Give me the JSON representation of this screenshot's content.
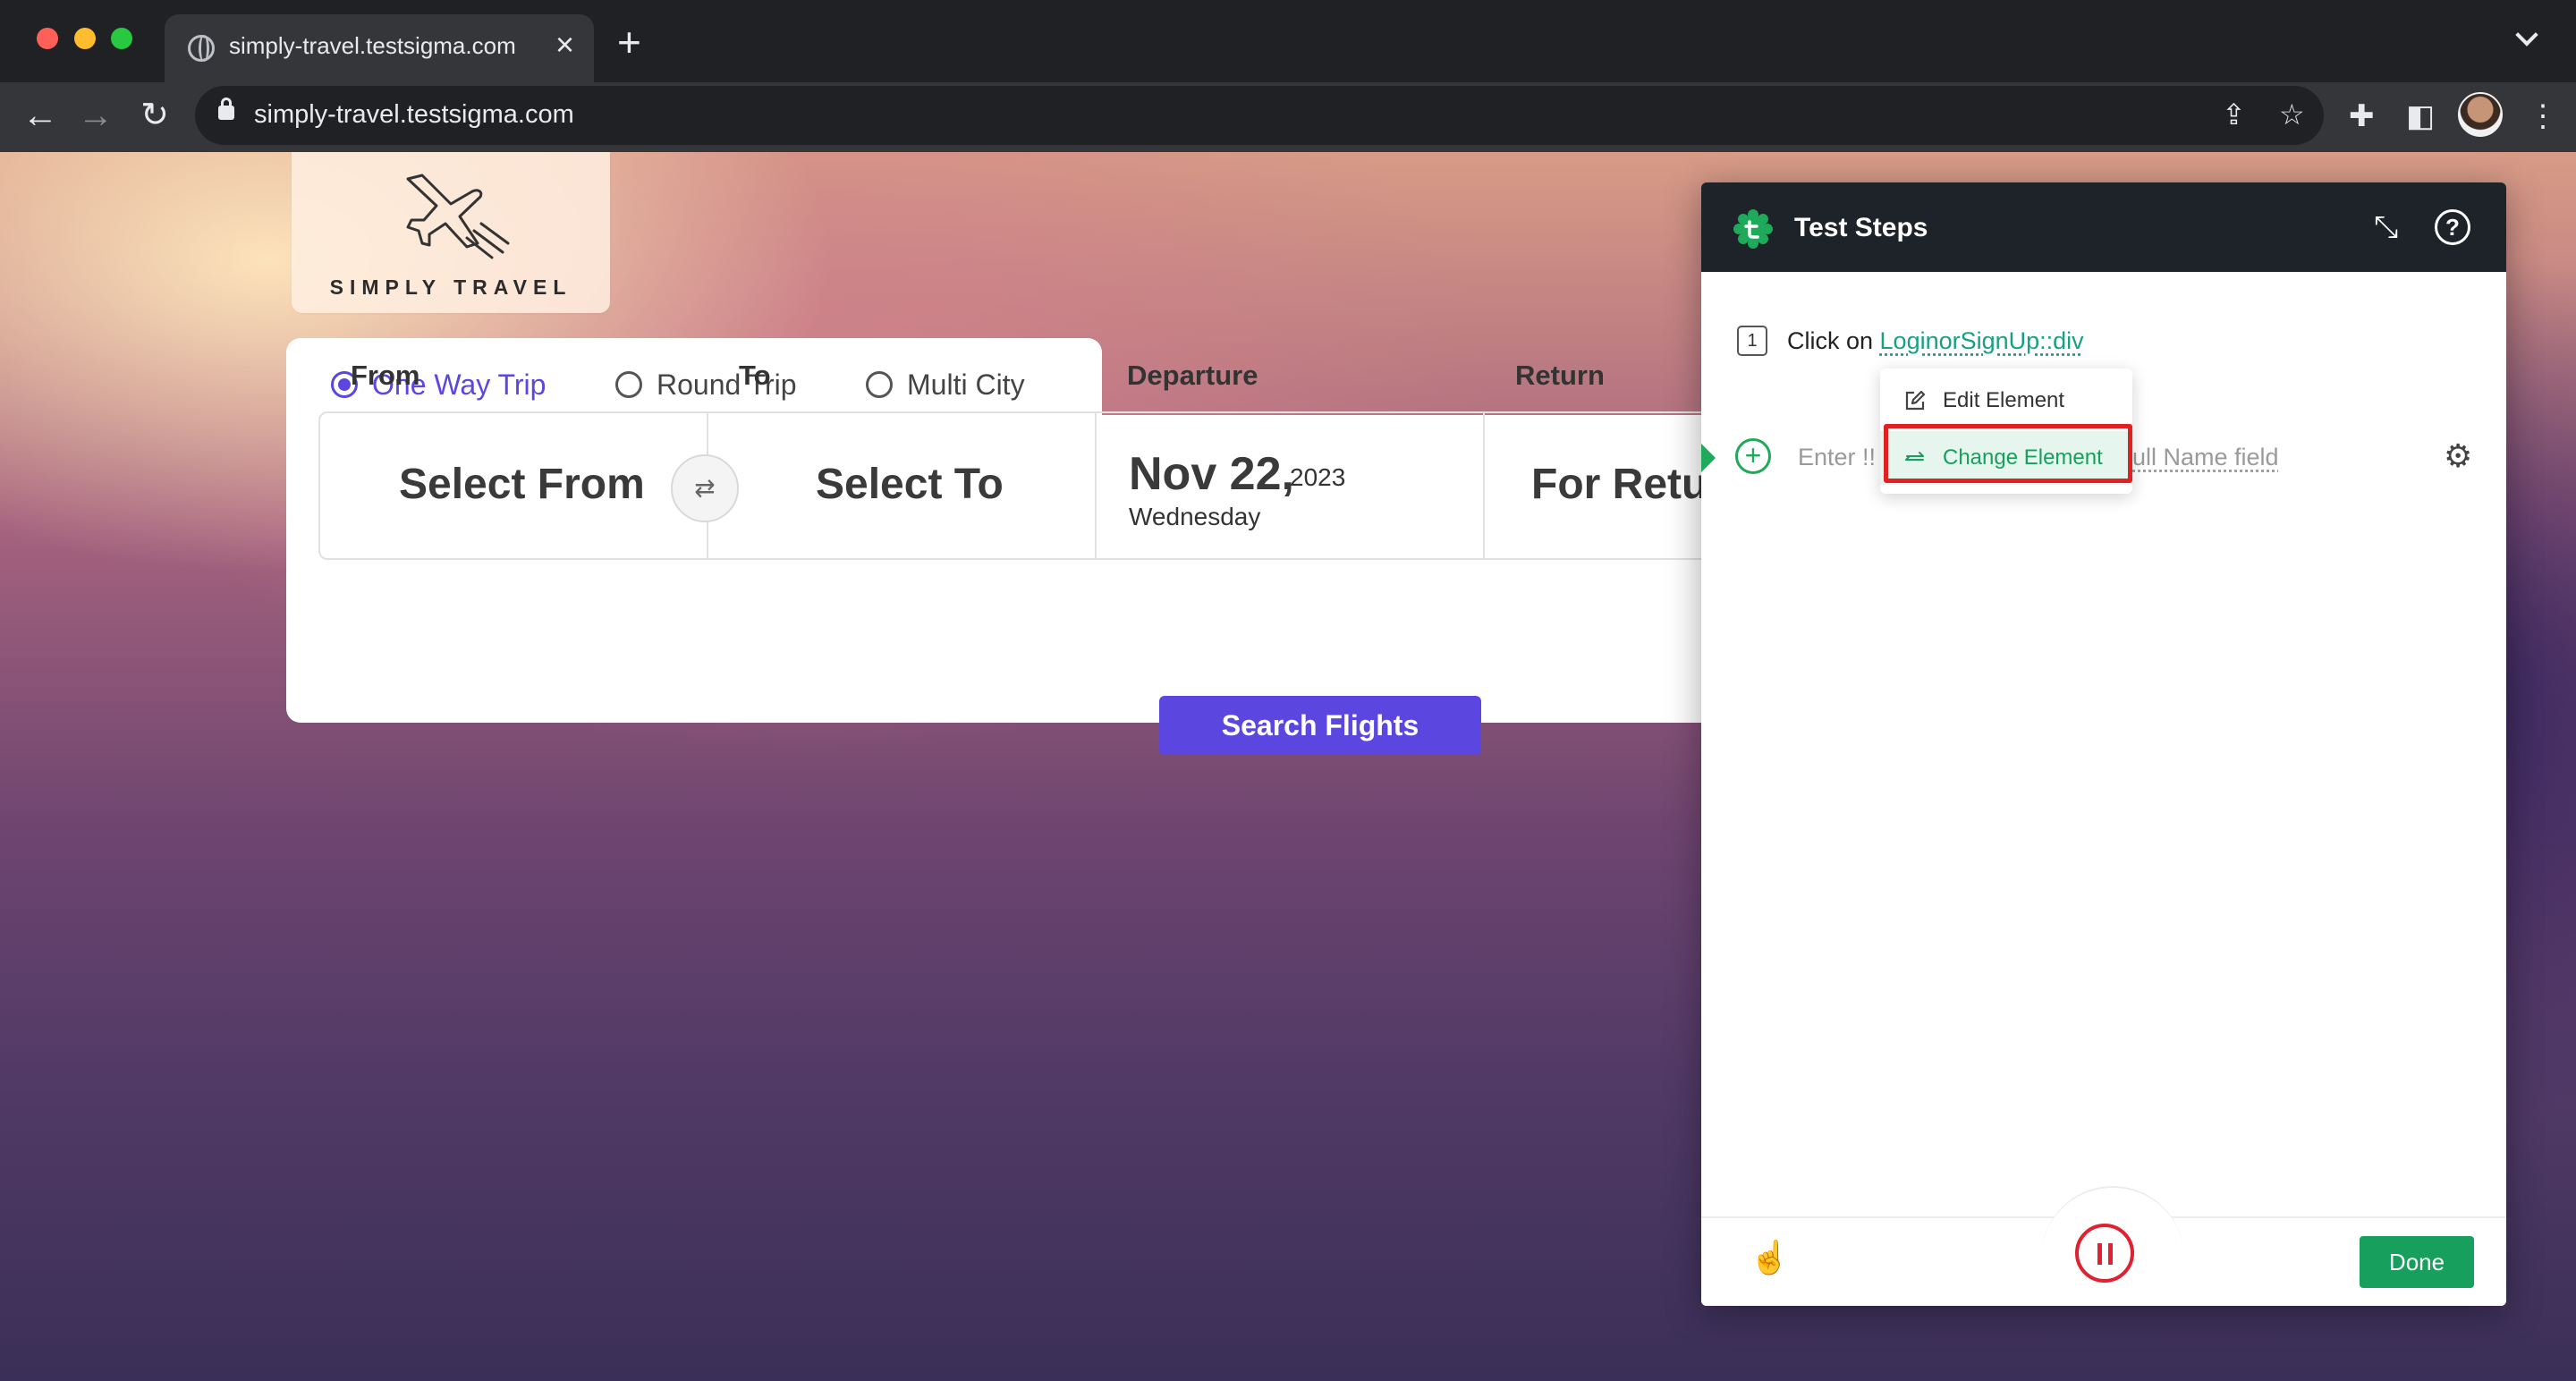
{
  "browser": {
    "tab_title": "simply-travel.testsigma.com",
    "url": "simply-travel.testsigma.com",
    "new_tab_symbol": "+",
    "close_tab_symbol": "×"
  },
  "site": {
    "logo_text": "SIMPLY TRAVEL",
    "trip_types": [
      {
        "label": "One Way Trip",
        "selected": true
      },
      {
        "label": "Round Trip",
        "selected": false
      },
      {
        "label": "Multi City",
        "selected": false
      }
    ],
    "labels": {
      "from": "From",
      "to": "To",
      "departure": "Departure",
      "return": "Return"
    },
    "from_value": "Select From",
    "to_value": "Select To",
    "swap_symbol": "⇄",
    "departure": {
      "date": "Nov 22,",
      "year": "2023",
      "weekday": "Wednesday"
    },
    "return_value": "For Retur",
    "search_button": "Search Flights",
    "accent_color": "#5b47e0"
  },
  "panel": {
    "title": "Test Steps",
    "step": {
      "number": "1",
      "prefix": "Click on ",
      "element": "LoginorSignUp::div"
    },
    "menu": {
      "edit": "Edit Element",
      "change": "Change Element"
    },
    "input_placeholder_start": "Enter !!",
    "input_placeholder_end": "ull Name field",
    "done_button": "Done",
    "accent_color": "#17a05d"
  }
}
